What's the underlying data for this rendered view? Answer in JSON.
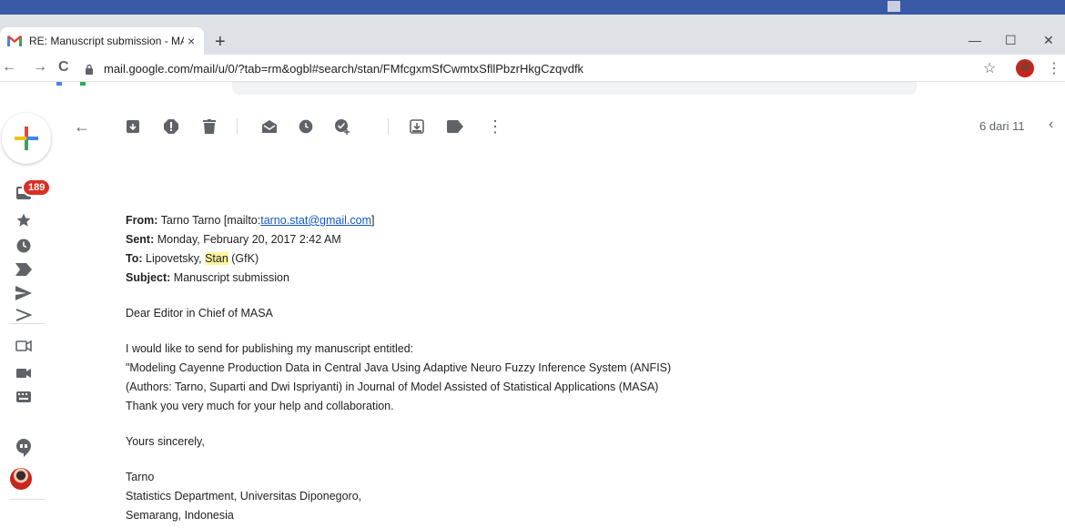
{
  "browser": {
    "tab_title": "RE: Manuscript submission - MA",
    "tab_close": "×",
    "new_tab": "+",
    "window_min": "—",
    "window_max": "☐",
    "window_close": "✕",
    "back": "←",
    "forward": "→",
    "reload": "C",
    "url": "mail.google.com/mail/u/0/?tab=rm&ogbl#search/stan/FMfcgxmSfCwmtxSfllPbzrHkgCzqvdfk",
    "star": "☆",
    "menu": "⋮"
  },
  "gmail": {
    "inbox_badge": "189",
    "pager": "6 dari 11",
    "pager_prev": "‹",
    "back_arrow": "←",
    "more": "⋮"
  },
  "email": {
    "from_label": "From:",
    "from_value_pre": "Tarno Tarno [mailto:",
    "from_link": "tarno.stat@gmail.com",
    "from_value_post": "]",
    "sent_label": "Sent:",
    "sent_value": "Monday, February 20, 2017 2:42 AM",
    "to_label": "To:",
    "to_value_pre": "Lipovetsky, ",
    "to_highlight": "Stan",
    "to_value_post": " (GfK)",
    "subject_label": "Subject:",
    "subject_value": "Manuscript submission",
    "greeting": "Dear Editor in Chief of MASA",
    "body_line1": "I would like to send for publishing my manuscript entitled:",
    "body_line2": "\"Modeling Cayenne Production Data in Central Java Using Adaptive  Neuro Fuzzy Inference System (ANFIS)",
    "body_line3": "(Authors: Tarno, Suparti and Dwi Ispriyanti) in Journal of Model Assisted of Statistical Applications (MASA)",
    "body_line4": "Thank you very much for your help and collaboration.",
    "closing": "Yours sincerely,",
    "sig_name": "Tarno",
    "sig_line1": "Statistics Department, Universitas Diponegoro,",
    "sig_line2": "Semarang, Indonesia"
  },
  "colors": {
    "badge": "#d93025",
    "link": "#1155cc",
    "highlight": "#fff59d"
  }
}
